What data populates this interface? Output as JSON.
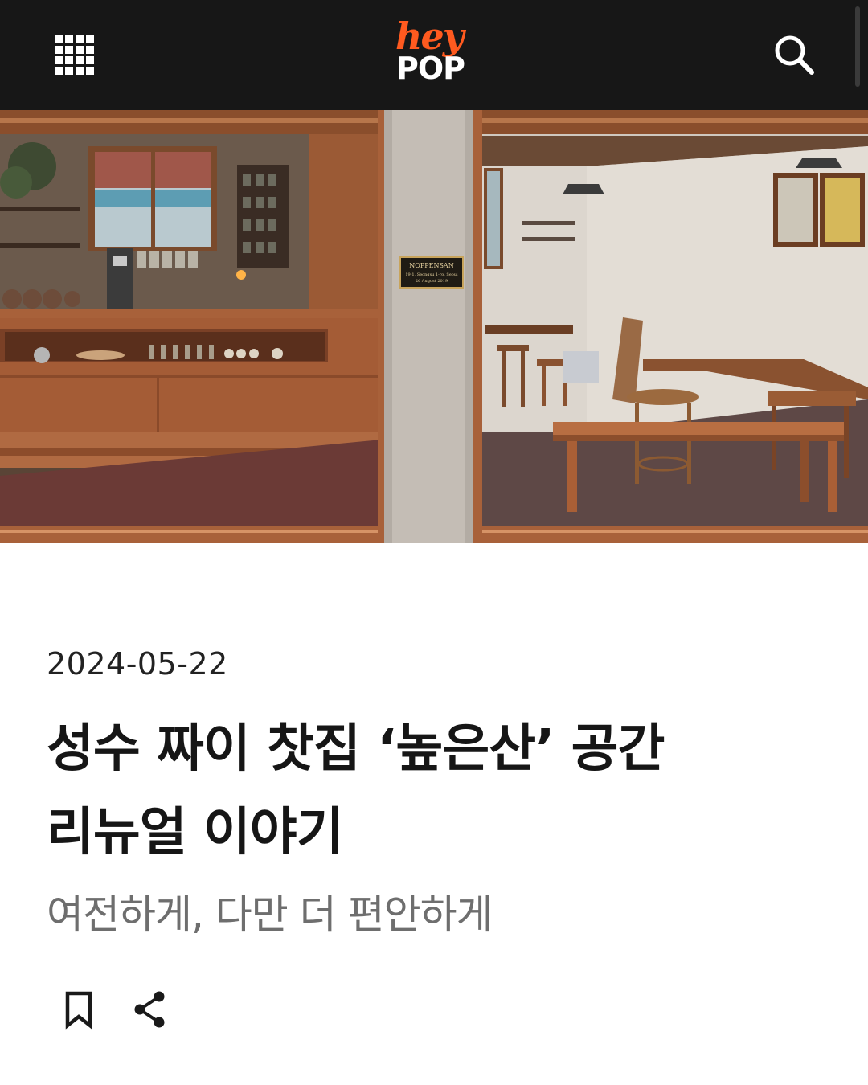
{
  "header": {
    "menu_icon": "grid-menu-icon",
    "logo_top": "hey",
    "logo_bottom": "POP",
    "search_icon": "search-icon"
  },
  "hero": {
    "plaque_line1": "NOPPENSAN",
    "plaque_line2": "19-1, Seongsu 1-ro, Seoul",
    "plaque_line3": "26 August 2019"
  },
  "article": {
    "date": "2024-05-22",
    "title_line1": "성수 짜이 찻집 ‘높은산’ 공간",
    "title_line2": "리뉴얼 이야기",
    "subtitle": "여전하게, 다만 더 편안하게"
  },
  "actions": {
    "bookmark_icon": "bookmark-icon",
    "share_icon": "share-icon"
  },
  "colors": {
    "header_bg": "#171717",
    "brand_orange": "#ff5a1f",
    "wood": "#a8613a"
  }
}
